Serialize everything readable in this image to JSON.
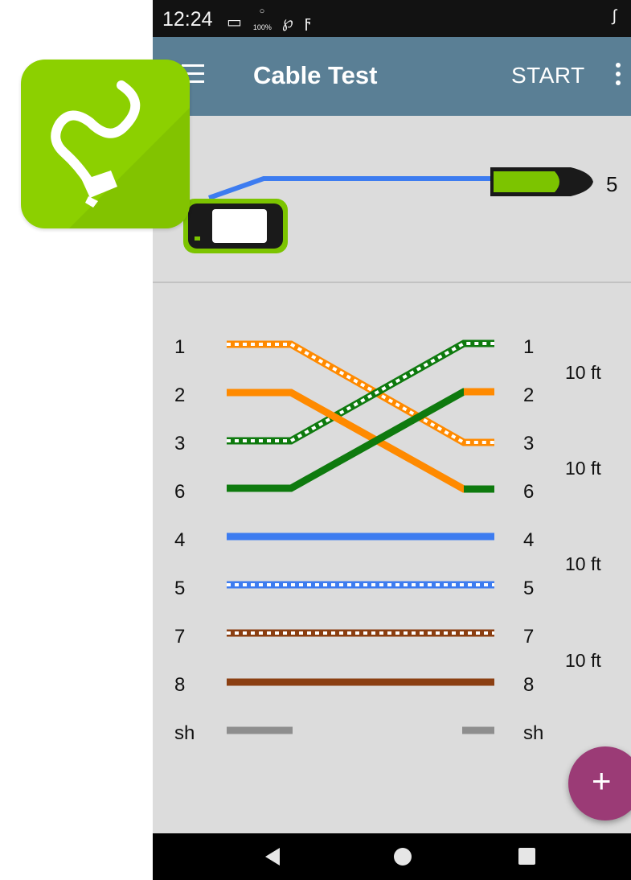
{
  "status_bar": {
    "time": "12:24",
    "battery_saver_label": "100%"
  },
  "app_bar": {
    "title": "Cable Test",
    "start_label": "START"
  },
  "remote": {
    "id_label": "5"
  },
  "wiremap": {
    "left_pins": [
      "1",
      "2",
      "3",
      "6",
      "4",
      "5",
      "7",
      "8",
      "sh"
    ],
    "right_pins": [
      "1",
      "2",
      "3",
      "6",
      "4",
      "5",
      "7",
      "8",
      "sh"
    ],
    "pair_lengths": [
      "10 ft",
      "10 ft",
      "10 ft",
      "10 ft"
    ]
  },
  "fab": {
    "label": "+"
  },
  "colors": {
    "app_bar": "#5a7f95",
    "orange": "#ff8a00",
    "green": "#0e7a0e",
    "blue": "#3d7cf0",
    "brown": "#8b3f12",
    "shield": "#8e8e8e",
    "accent_green": "#7cc400",
    "fab": "#9b3b76"
  }
}
